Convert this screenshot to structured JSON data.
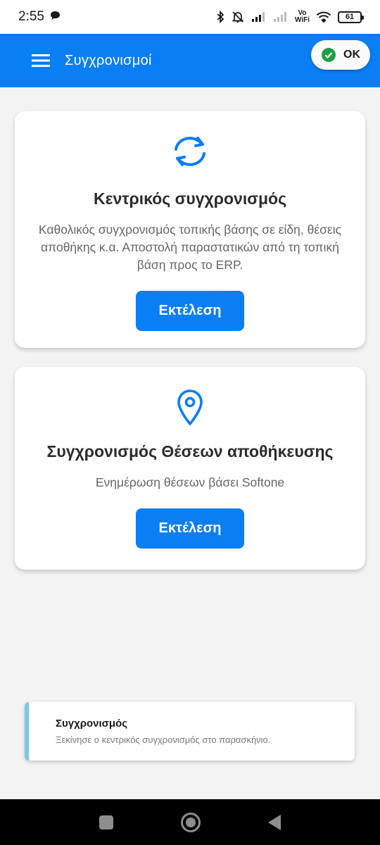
{
  "status_bar": {
    "time": "2:55",
    "vowifi_top": "Vo",
    "vowifi_bottom": "WiFi",
    "battery": "61"
  },
  "app_bar": {
    "title": "Συγχρονισμοί",
    "status_pill_label": "OK"
  },
  "cards": [
    {
      "icon": "sync-icon",
      "title": "Κεντρικός συγχρονισμός",
      "description": "Καθολικός συγχρονισμός τοπικής βάσης σε είδη, θέσεις αποθήκης κ.α. Αποστολή παραστατικών από τη τοπική βάση προς το ERP.",
      "button_label": "Εκτέλεση"
    },
    {
      "icon": "location-pin-icon",
      "title": "Συγχρονισμός Θέσεων αποθήκευσης",
      "description": "Ενημέρωση θέσεων βάσει Softone",
      "button_label": "Εκτέλεση"
    }
  ],
  "toast": {
    "title": "Συγχρονισμός",
    "message": "Ξεκίνησε ο κεντρικός συγχρονισμός στο παρασκήνιο."
  },
  "colors": {
    "primary": "#0a7ef5",
    "toast_accent": "#7dc6f0",
    "ok_check": "#1e9e45"
  }
}
